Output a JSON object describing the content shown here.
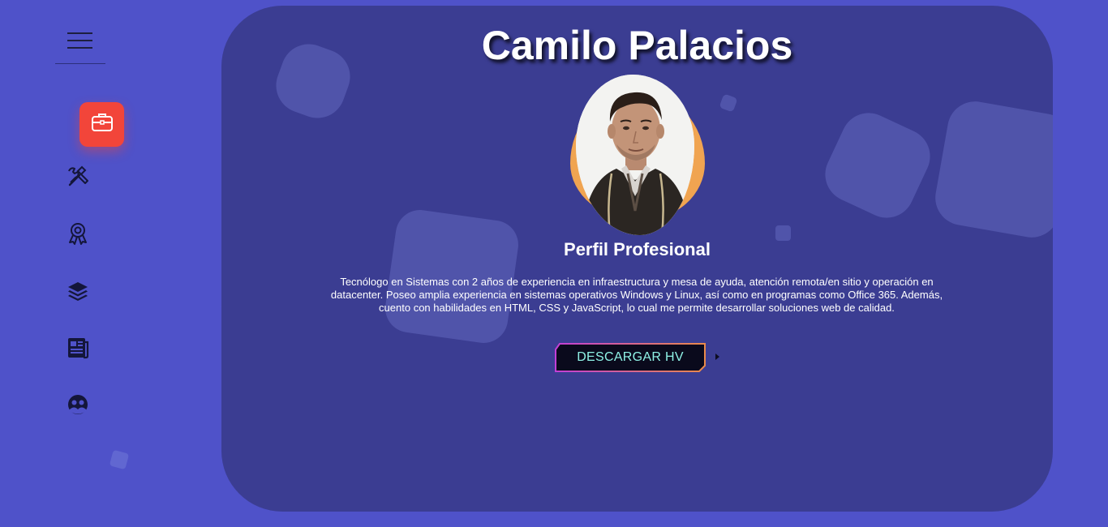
{
  "profile": {
    "name": "Camilo Palacios",
    "section_title": "Perfil Profesional",
    "description": "Tecnólogo en Sistemas con 2 años de experiencia en infraestructura y mesa de ayuda, atención remota/en sitio y operación en datacenter. Poseo amplia experiencia en sistemas operativos Windows y Linux, así como en programas como Office 365. Además, cuento con habilidades en HTML, CSS y JavaScript, lo cual me permite desarrollar soluciones web de calidad.",
    "download_label": "DESCARGAR HV"
  },
  "sidebar": {
    "items": [
      {
        "icon": "briefcase-icon",
        "active": true
      },
      {
        "icon": "tools-icon",
        "active": false
      },
      {
        "icon": "award-icon",
        "active": false
      },
      {
        "icon": "layers-icon",
        "active": false
      },
      {
        "icon": "newspaper-icon",
        "active": false
      },
      {
        "icon": "contact-icon",
        "active": false
      }
    ]
  },
  "colors": {
    "page_background": "#4f52c9",
    "card_background": "#3b3d92",
    "active_nav": "#f2453a",
    "photo_blob": "#f0a451",
    "button_text": "#8ff2e6",
    "button_bg": "#0a0a1c"
  }
}
